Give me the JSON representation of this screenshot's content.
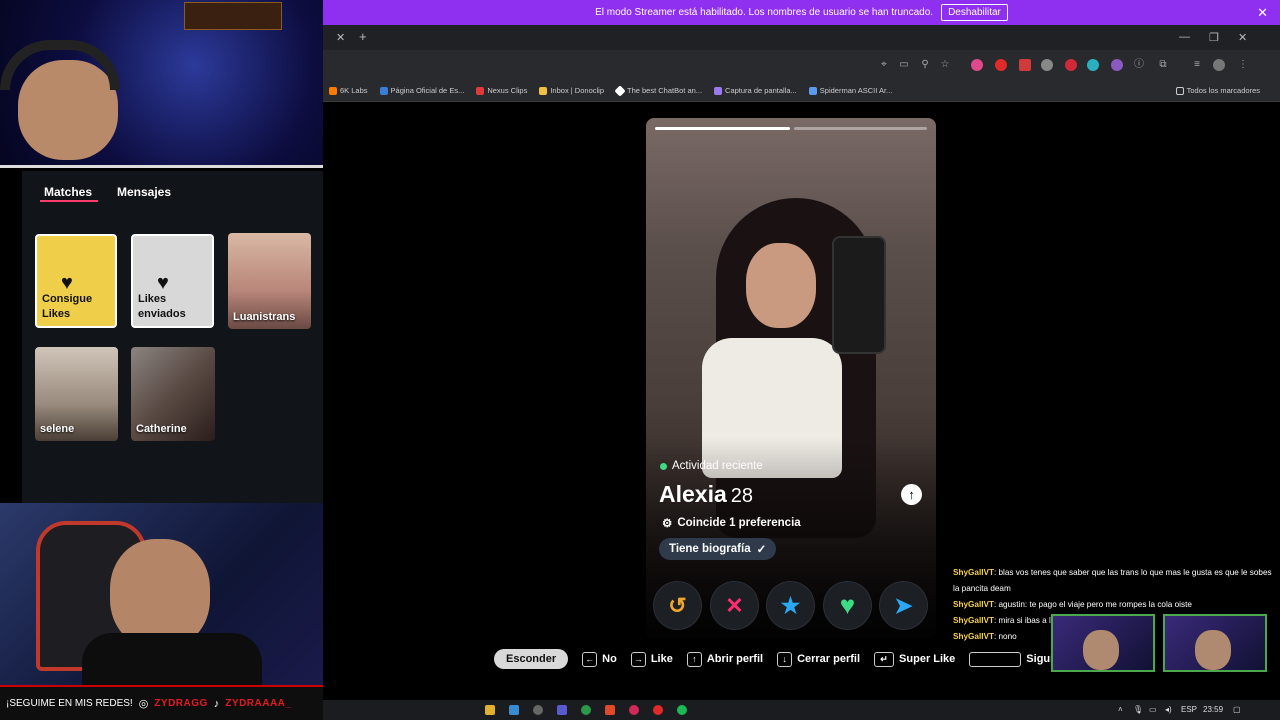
{
  "banner": {
    "text": "El modo Streamer está habilitado. Los nombres de usuario se han truncado.",
    "button": "Deshabilitar",
    "close": "✕"
  },
  "browser": {
    "tab_close": "✕",
    "new_tab": "+",
    "window_controls": [
      "—",
      "❐",
      "✕"
    ],
    "bookmarks": [
      {
        "label": "6K Labs",
        "color": "#ff7a00"
      },
      {
        "label": "Página Oficial de Es...",
        "color": "#3d7bd9"
      },
      {
        "label": "Nexus Clips",
        "color": "#e03a3a"
      },
      {
        "label": "Inbox | Donoclip",
        "color": "#f0c040"
      },
      {
        "label": "The best ChatBot an...",
        "color": "#ffffff"
      },
      {
        "label": "Captura de pantalla...",
        "color": "#9a7af0"
      },
      {
        "label": "Spiderman ASCII Ar...",
        "color": "#5a9af0"
      }
    ],
    "all_bookmarks": "Todos los marcadores"
  },
  "tinder": {
    "tabs": {
      "matches": "Matches",
      "messages": "Mensajes"
    },
    "cards": {
      "likes_get": "Consigue Likes",
      "likes_sent": "Likes enviados",
      "match1": "Luanistrans",
      "match2": "selene",
      "match3": "Catherine"
    },
    "profile": {
      "activity": "Actividad reciente",
      "name": "Alexia",
      "age": "28",
      "preference": "Coincide 1 preferencia",
      "bio": "Tiene biografía"
    },
    "actions": {
      "rewind": "↺",
      "nope": "✕",
      "superlike": "★",
      "like": "♥",
      "boost": "➤"
    },
    "shortcuts": {
      "hide": "Esconder",
      "no": "No",
      "like": "Like",
      "open_profile": "Abrir perfil",
      "close_profile": "Cerrar perfil",
      "super_like": "Super Like",
      "next": "Siguie"
    }
  },
  "chat": [
    {
      "user": "ShyGallVT",
      "text": ": blas vos tenes que saber que las trans lo que mas le gusta es que le sobes la pancita deam"
    },
    {
      "user": "ShyGallVT",
      "text": ": agustin: te pago el viaje pero me rompes la cola oiste"
    },
    {
      "user": "ShyGallVT",
      "text": ": mira si ibas a la primaria con agus"
    },
    {
      "user": "ShyGallVT",
      "text": ": nono"
    }
  ],
  "social": {
    "text": "¡SEGUIME EN MIS REDES!",
    "handle1": "ZYDRAGG",
    "handle2": "ZYDRAAAA_"
  },
  "taskbar": {
    "lang": "ESP",
    "time": "23:59"
  },
  "colors": {
    "banner": "#8f2ff0",
    "tinder_accent": "#fd3c6b",
    "nope": "#ff2d6f",
    "superlike": "#2aa8f5",
    "like": "#3ddc84",
    "rewind": "#f2a52b",
    "boost": "#2aa8f5"
  }
}
